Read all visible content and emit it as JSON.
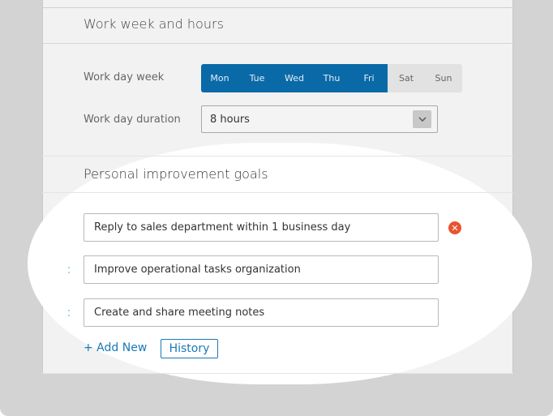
{
  "work_week": {
    "section_title": "Work week and hours",
    "work_day_week_label": "Work day week",
    "days": [
      {
        "label": "Mon",
        "selected": true
      },
      {
        "label": "Tue",
        "selected": true
      },
      {
        "label": "Wed",
        "selected": true
      },
      {
        "label": "Thu",
        "selected": true
      },
      {
        "label": "Fri",
        "selected": true
      },
      {
        "label": "Sat",
        "selected": false
      },
      {
        "label": "Sun",
        "selected": false
      }
    ],
    "work_day_duration_label": "Work day duration",
    "work_day_duration_value": "8 hours"
  },
  "goals": {
    "section_title": "Personal improvement goals",
    "items": [
      {
        "value": "Reply to sales department within 1 business day"
      },
      {
        "value": "Improve operational tasks organization"
      },
      {
        "value": "Create and share meeting notes"
      }
    ],
    "add_new_label": "+ Add New",
    "history_label": "History"
  },
  "colors": {
    "accent": "#0a6aa8",
    "link": "#1a7ab8",
    "remove": "#e8542e"
  }
}
